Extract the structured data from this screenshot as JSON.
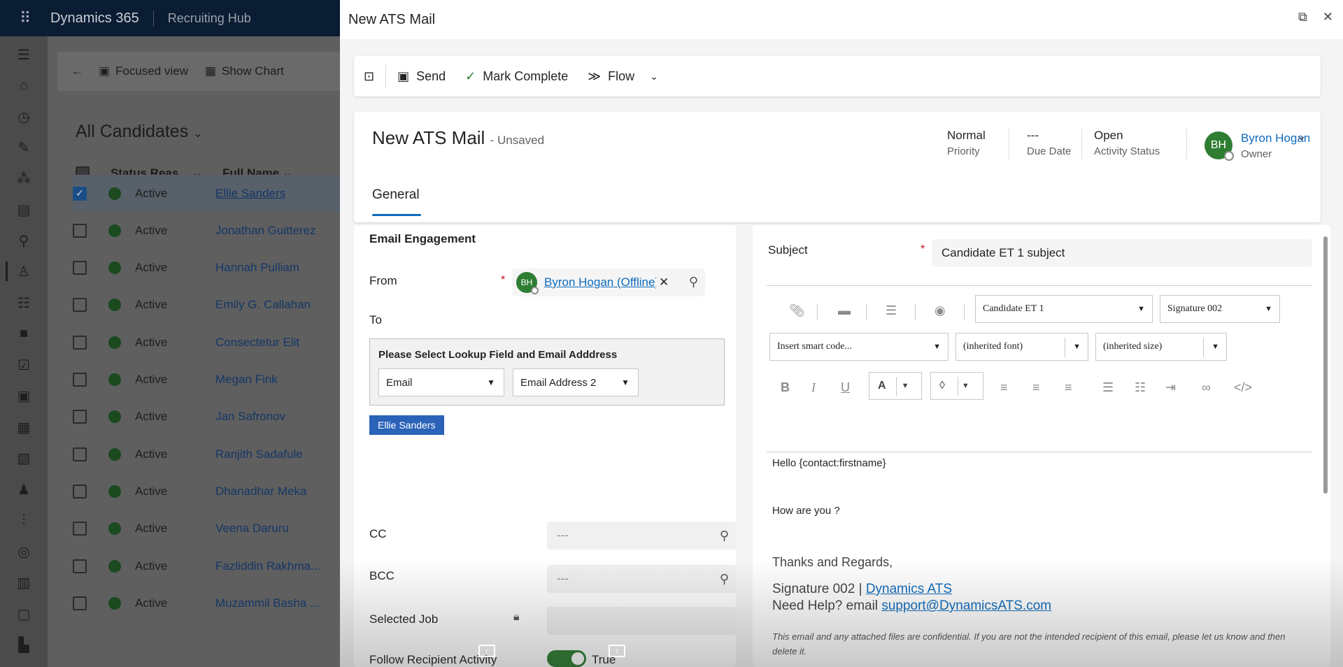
{
  "app": {
    "brand": "Dynamics 365",
    "hub": "Recruiting Hub"
  },
  "background": {
    "commands": {
      "focused": "Focused view",
      "chart": "Show Chart"
    },
    "view_title": "All Candidates",
    "columns": {
      "status": "Status Reas...",
      "name": "Full Name"
    },
    "rows": [
      {
        "status": "Active",
        "name": "Ellie Sanders"
      },
      {
        "status": "Active",
        "name": "Jonathan Guitterez"
      },
      {
        "status": "Active",
        "name": "Hannah Pulliam"
      },
      {
        "status": "Active",
        "name": "Emily G. Callahan"
      },
      {
        "status": "Active",
        "name": "Consectetur Elit"
      },
      {
        "status": "Active",
        "name": "Megan Fink"
      },
      {
        "status": "Active",
        "name": "Jan Safronov"
      },
      {
        "status": "Active",
        "name": "Ranjith Sadafule"
      },
      {
        "status": "Active",
        "name": "Dhanadhar Meka"
      },
      {
        "status": "Active",
        "name": "Veena Daruru"
      },
      {
        "status": "Active",
        "name": "Fazliddin Rakhma..."
      },
      {
        "status": "Active",
        "name": "Muzammil Basha ..."
      }
    ]
  },
  "panel": {
    "title": "New ATS Mail",
    "toolbar": {
      "send": "Send",
      "complete": "Mark Complete",
      "flow": "Flow"
    },
    "form_title": "New ATS Mail",
    "unsaved": "- Unsaved",
    "priority": {
      "value": "Normal",
      "label": "Priority"
    },
    "due": {
      "value": "---",
      "label": "Due Date"
    },
    "activity": {
      "value": "Open",
      "label": "Activity Status"
    },
    "owner": {
      "initials": "BH",
      "name": "Byron Hogan",
      "label": "Owner"
    },
    "tab": "General"
  },
  "engagement": {
    "title": "Email Engagement",
    "from_label": "From",
    "from_initials": "BH",
    "from_value": "Byron Hogan (Offline)",
    "to_label": "To",
    "pick_title": "Please Select Lookup Field and Email Adddress",
    "lookup_field": "Email",
    "email_field": "Email Address 2",
    "recipient": "Ellie Sanders",
    "cc_label": "CC",
    "cc_value": "---",
    "bcc_label": "BCC",
    "bcc_value": "---",
    "job_label": "Selected Job",
    "follow_label": "Follow Recipient Activity",
    "follow_value": "True"
  },
  "email": {
    "subject_label": "Subject",
    "subject_value": "Candidate ET 1 subject",
    "template": "Candidate ET 1",
    "signature": "Signature 002",
    "smart_code": "Insert smart code...",
    "font": "(inherited font)",
    "size": "(inherited size)",
    "greeting": "Hello {contact:firstname}",
    "question": "How are you ?",
    "closing": "Thanks and Regards,",
    "sig_prefix": "Signature 002 | ",
    "sig_link": "Dynamics ATS",
    "help_prefix": "Need Help? email ",
    "help_link": "support@DynamicsATS.com",
    "disclaimer": "This email and any attached files are confidential. If you are not the intended recipient of this email, please let us know and then delete it."
  }
}
